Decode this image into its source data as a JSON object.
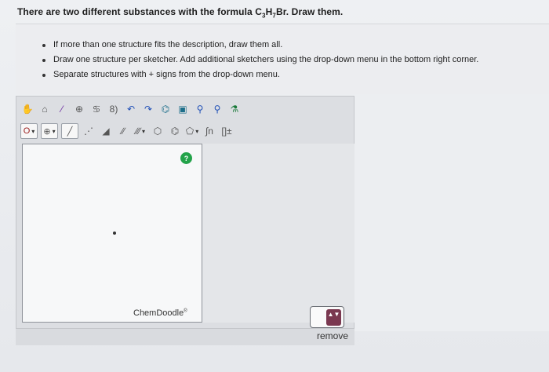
{
  "question": {
    "prefix": "There are two different substances with the formula C",
    "sub1": "3",
    "mid": "H",
    "sub2": "7",
    "suffix": "Br. Draw them."
  },
  "instructions": [
    "If more than one structure fits the description, draw them all.",
    "Draw one structure per sketcher. Add additional sketchers using the drop-down menu in the bottom right corner.",
    "Separate structures with + signs from the drop-down menu."
  ],
  "toolbar_row1": [
    {
      "name": "hand-icon",
      "glyph": "✋",
      "color": "blue"
    },
    {
      "name": "lasso-icon",
      "glyph": "⌂",
      "color": "gray"
    },
    {
      "name": "eraser-icon",
      "glyph": "⁄",
      "color": "purple"
    },
    {
      "name": "center-icon",
      "glyph": "⊕",
      "color": "gray"
    },
    {
      "name": "rotate-icon",
      "glyph": "♋",
      "color": "gray"
    },
    {
      "name": "flip-icon",
      "glyph": "8)",
      "color": "gray"
    },
    {
      "name": "undo-icon",
      "glyph": "↶",
      "color": "blue"
    },
    {
      "name": "redo-icon",
      "glyph": "↷",
      "color": "blue"
    },
    {
      "name": "template-icon",
      "glyph": "⌬",
      "color": "teal"
    },
    {
      "name": "save-icon",
      "glyph": "▣",
      "color": "teal"
    },
    {
      "name": "zoom-in-icon",
      "glyph": "⚲",
      "color": "blue"
    },
    {
      "name": "zoom-out-icon",
      "glyph": "⚲",
      "color": "blue"
    },
    {
      "name": "clean-icon",
      "glyph": "⚗",
      "color": "green"
    }
  ],
  "toolbar_row2": [
    {
      "name": "element-dropdown",
      "label": "O",
      "box": true,
      "caret": true,
      "color": "red"
    },
    {
      "name": "charge-dropdown",
      "label": "⊕",
      "box": true,
      "caret": true,
      "color": "gray"
    },
    {
      "name": "single-bond-icon",
      "label": "╱",
      "box": true,
      "caret": false,
      "color": "gray"
    },
    {
      "name": "dashed-bond-icon",
      "label": "⋰",
      "box": false,
      "caret": false,
      "color": "gray"
    },
    {
      "name": "wedge-bond-icon",
      "label": "◢",
      "box": false,
      "caret": false,
      "color": "gray"
    },
    {
      "name": "double-bond-icon",
      "label": "∕∕",
      "box": false,
      "caret": false,
      "color": "gray"
    },
    {
      "name": "triple-bond-icon",
      "label": "∕∕∕",
      "box": false,
      "caret": true,
      "color": "gray"
    },
    {
      "name": "hexagon-ring-icon",
      "label": "⬡",
      "box": false,
      "caret": false,
      "color": "gray"
    },
    {
      "name": "benzene-ring-icon",
      "label": "⌬",
      "box": false,
      "caret": false,
      "color": "gray"
    },
    {
      "name": "pentagon-ring-icon",
      "label": "⬠",
      "box": false,
      "caret": true,
      "color": "gray"
    },
    {
      "name": "chain-icon",
      "label": "∫n",
      "box": false,
      "caret": false,
      "color": "gray"
    },
    {
      "name": "bracket-icon",
      "label": "[]±",
      "box": false,
      "caret": false,
      "color": "gray"
    }
  ],
  "canvas": {
    "help_label": "?",
    "watermark": "ChemDoodle",
    "watermark_mark": "®"
  },
  "dropdown": {
    "glyph": "▲▼"
  },
  "remove_label": "remove"
}
